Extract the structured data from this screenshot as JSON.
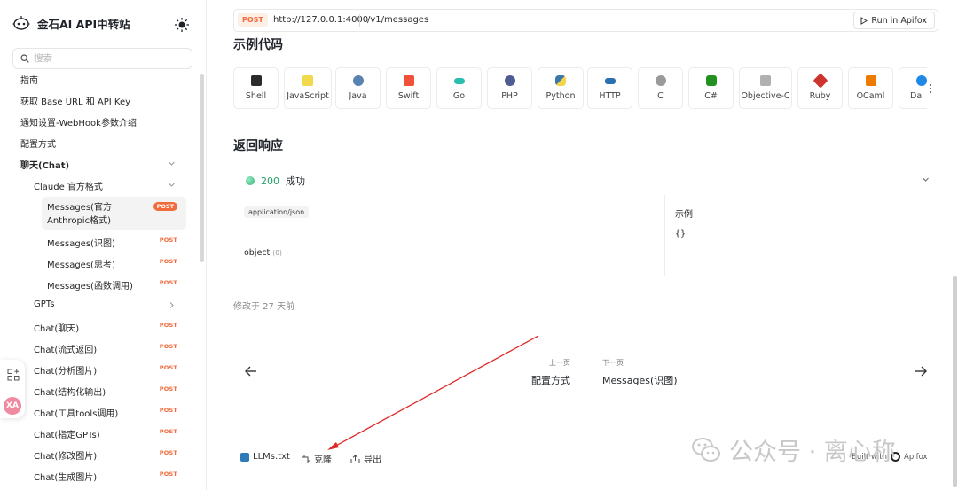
{
  "brand": {
    "title": "金石AI API中转站"
  },
  "search": {
    "placeholder": "搜索"
  },
  "sidebar": {
    "top_items": [
      {
        "label": "指南"
      },
      {
        "label": "获取 Base URL 和 API Key"
      },
      {
        "label": "通知设置-WebHook参数介绍"
      },
      {
        "label": "配置方式"
      }
    ],
    "chat_group": {
      "label": "聊天(Chat)"
    },
    "claude_group": {
      "label": "Claude 官方格式"
    },
    "active_item": {
      "label": "Messages(官方Anthropic格式)",
      "method": "POST"
    },
    "claude_items": [
      {
        "label": "Messages(识图)",
        "method": "POST"
      },
      {
        "label": "Messages(思考)",
        "method": "POST"
      },
      {
        "label": "Messages(函数调用)",
        "method": "POST"
      }
    ],
    "gpts": {
      "label": "GPTs"
    },
    "chat_items": [
      {
        "label": "Chat(聊天)",
        "method": "POST"
      },
      {
        "label": "Chat(流式返回)",
        "method": "POST"
      },
      {
        "label": "Chat(分析图片)",
        "method": "POST"
      },
      {
        "label": "Chat(结构化输出)",
        "method": "POST"
      },
      {
        "label": "Chat(工具tools调用)",
        "method": "POST"
      },
      {
        "label": "Chat(指定GPTs)",
        "method": "POST"
      },
      {
        "label": "Chat(修改图片)",
        "method": "POST"
      },
      {
        "label": "Chat(生成图片)",
        "method": "POST"
      }
    ],
    "float_badge": "XA"
  },
  "request": {
    "method": "POST",
    "base_url": "http://127.0.0.1:4000",
    "path": "/v1/messages",
    "run_label": "Run in Apifox"
  },
  "code_samples": {
    "title": "示例代码",
    "languages": [
      {
        "name": "Shell",
        "color": "#2b2b2b"
      },
      {
        "name": "JavaScript",
        "color": "#f0d94a"
      },
      {
        "name": "Java",
        "color": "#5a82b0"
      },
      {
        "name": "Swift",
        "color": "#f05138"
      },
      {
        "name": "Go",
        "color": "#29beb0"
      },
      {
        "name": "PHP",
        "color": "#4f5b93"
      },
      {
        "name": "Python",
        "color": "#3c78aa"
      },
      {
        "name": "HTTP",
        "color": "#2a6fb0"
      },
      {
        "name": "C",
        "color": "#9a9a9a"
      },
      {
        "name": "C#",
        "color": "#239120"
      },
      {
        "name": "Objective-C",
        "color": "#b0b0b0"
      },
      {
        "name": "Ruby",
        "color": "#cc342d"
      },
      {
        "name": "OCaml",
        "color": "#ee7a00"
      },
      {
        "name": "Da",
        "color": "#1e88e5"
      }
    ]
  },
  "response": {
    "title": "返回响应",
    "status_code": "200",
    "status_text": "成功",
    "content_type": "application/json",
    "schema_type": "object",
    "schema_count": "(0)",
    "example_title": "示例",
    "example_body": "{}"
  },
  "meta": {
    "modified": "修改于 27 天前"
  },
  "pager": {
    "prev_caption": "上一页",
    "prev_title": "配置方式",
    "next_caption": "下一页",
    "next_title": "Messages(识图)"
  },
  "footer": {
    "llms": "LLMs.txt",
    "clone": "克隆",
    "export": "导出",
    "built_with": "Built with",
    "built_brand": "Apifox"
  },
  "watermark": {
    "text": "公众号 · 离心称"
  }
}
